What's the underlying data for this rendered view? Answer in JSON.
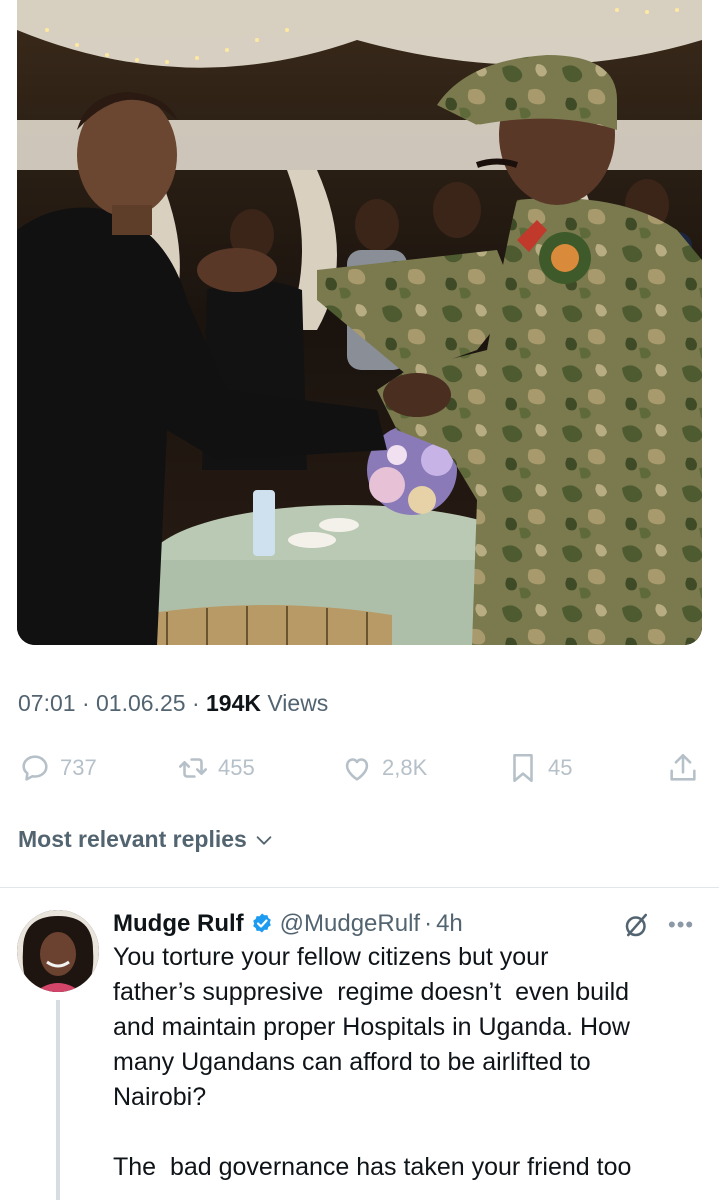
{
  "tweet": {
    "photo": {
      "alt_subject": "photo"
    },
    "time": "07:01",
    "date": "01.06.25",
    "separator": "·",
    "views_count": "194K",
    "views_label": "Views",
    "actions": {
      "replies": "737",
      "reposts": "455",
      "likes": "2,8K",
      "bookmarks": "45"
    }
  },
  "replies_section": {
    "sort_label": "Most relevant replies"
  },
  "reply": {
    "name": "Mudge Rulf",
    "handle": "@MudgeRulf",
    "separator": "·",
    "age": "4h",
    "text": "You torture your fellow citizens but your\nfather’s suppresive  regime doesn’t  even build\nand maintain proper Hospitals in Uganda. How\nmany Ugandans can afford to be airlifted to\nNairobi?\n\nThe  bad governance has taken your friend too"
  },
  "colors": {
    "text_primary": "#0f1419",
    "text_secondary": "#536471",
    "icon_muted": "#b6c0c8",
    "verified_blue": "#1d9bf0",
    "divider": "#e1e6ea"
  },
  "icons": {
    "reply": "comment-icon",
    "repost": "repost-icon",
    "like": "heart-icon",
    "bookmark": "bookmark-icon",
    "share": "share-icon",
    "verified": "verified-badge-icon",
    "grok": "grok-icon",
    "more": "more-icon",
    "chevron": "chevron-down-icon"
  }
}
